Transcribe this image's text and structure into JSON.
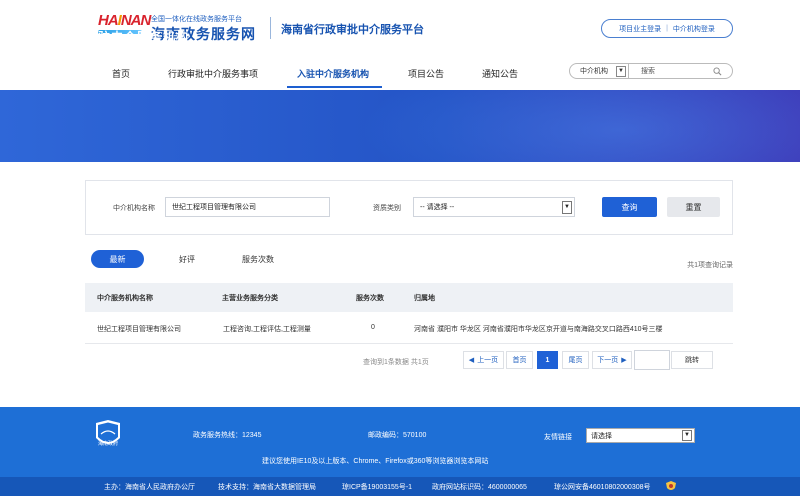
{
  "header": {
    "logo_text": "HAINAN",
    "logo_subtitle": "全国一体化在线政务服务平台",
    "logo_title": "海南政务服务网",
    "platform_title": "海南省行政审批中介服务平台",
    "login_owner": "项目业主登录",
    "login_agency": "中介机构登录"
  },
  "nav": {
    "items": [
      "首页",
      "行政审批中介服务事项",
      "入驻中介服务机构",
      "项目公告",
      "通知公告"
    ],
    "search_type": "中介机构",
    "search_placeholder": "搜索"
  },
  "banner": {
    "title": "入驻中介服务机构"
  },
  "filter": {
    "name_label": "中介机构名称",
    "name_value": "世纪工程项目管理有限公司",
    "category_label": "资质类别",
    "category_value": "-- 请选择 --",
    "query_button": "查询",
    "reset_button": "重置"
  },
  "sort_tabs": [
    "最新",
    "好评",
    "服务次数"
  ],
  "result_count": "共1项查询记录",
  "table": {
    "headers": [
      "中介服务机构名称",
      "主营业务服务分类",
      "服务次数",
      "归属地"
    ],
    "rows": [
      [
        "世纪工程项目管理有限公司",
        "工程咨询,工程评估,工程测量",
        "0",
        "河南省 濮阳市 华龙区 河南省濮阳市华龙区京开道与南海路交叉口路西410号三楼"
      ]
    ]
  },
  "pagination": {
    "info": "查询到1条数据 共1页",
    "prev": "上一页",
    "first": "首页",
    "current": "1",
    "last": "尾页",
    "next": "下一页",
    "go": "跳转"
  },
  "footer": {
    "logo_label": "海南政府",
    "hotline": "政务服务热线：12345",
    "postcode": "邮政编码：570100",
    "links_label": "友情链接",
    "links_select": "请选择",
    "browser_tip": "建议您使用IE10及以上版本、Chrome、Firefox或360等浏览器浏览本网站",
    "sponsor": "主办：海南省人民政府办公厅",
    "tech": "技术支持：海南省大数据管理局",
    "icp": "琼ICP备19003155号-1",
    "site_code": "政府网站标识码：4600000065",
    "police": "琼公网安备46010802000308号"
  },
  "colors": {
    "primary": "#1f61d6",
    "banner": "#2454c6",
    "footer": "#1e6fd6"
  }
}
